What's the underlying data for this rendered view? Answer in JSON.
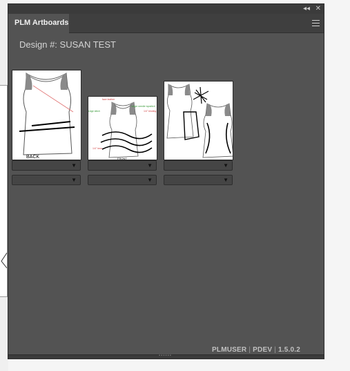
{
  "panel": {
    "title": "PLM Artboards",
    "collapse_icon": "double-chevron-left-icon",
    "close_icon": "close-icon",
    "menu_icon": "hamburger-menu-icon"
  },
  "design": {
    "label": "Design #:",
    "value": "SUSAN TEST"
  },
  "artboards": [
    {
      "caption": "BACK",
      "dropdown1": "",
      "dropdown2": ""
    },
    {
      "caption": "FRONT",
      "notes": [
        "face leather",
        "single needle topstitch",
        "1/4\" binding",
        "edge stitch",
        "1/4\" hem"
      ],
      "dropdown1": "",
      "dropdown2": ""
    },
    {
      "caption": "",
      "dropdown1": "",
      "dropdown2": ""
    }
  ],
  "footer": {
    "user": "PLMUSER",
    "env": "PDEV",
    "version": "1.5.0.2"
  },
  "colors": {
    "panel_bg": "#535353",
    "titlebar_bg": "#3b3b3b",
    "dropdown_bg": "#454545"
  }
}
